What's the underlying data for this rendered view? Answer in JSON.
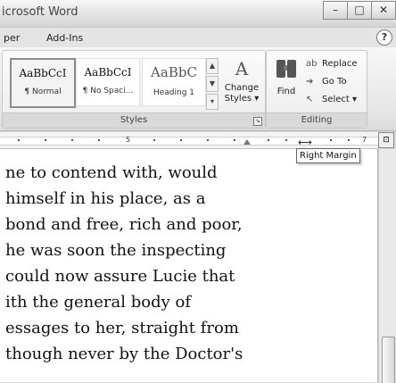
{
  "window": {
    "title": "icrosoft Word",
    "minimize": "–",
    "maximize": "□",
    "close": "✕"
  },
  "tabs": [
    {
      "label": "per"
    },
    {
      "label": "Add-Ins"
    }
  ],
  "help": "?",
  "styles_group": {
    "label": "Styles",
    "swatches": [
      {
        "sample": "AaBbCcI",
        "name": "¶ Normal"
      },
      {
        "sample": "AaBbCcI",
        "name": "¶ No Spaci..."
      },
      {
        "sample": "AaBbC",
        "name": "Heading 1"
      }
    ],
    "scroll_up": "▲",
    "scroll_down": "▼",
    "scroll_more": "▾",
    "change_styles_icon": "A",
    "change_styles_line1": "Change",
    "change_styles_line2": "Styles ▾",
    "launcher": "↘"
  },
  "editing_group": {
    "label": "Editing",
    "find_label": "Find",
    "items": [
      {
        "icon": "ab",
        "label": "Replace"
      },
      {
        "icon": "➔",
        "label": "Go To"
      },
      {
        "icon": "↖",
        "label": "Select ▾"
      }
    ]
  },
  "ruler": {
    "mark_5": "5",
    "mark_7": "7",
    "view_ruler_icon": "⊡",
    "margin_marker": "⟷",
    "tooltip": "Right Margin"
  },
  "document": {
    "lines": [
      "ne to contend with, would",
      "himself in his place, as a",
      "bond and free, rich and poor,",
      "he was soon the inspecting",
      " could now assure Lucie that",
      "ith the general body of",
      "essages to her, straight from",
      "though never by the Doctor's"
    ]
  }
}
